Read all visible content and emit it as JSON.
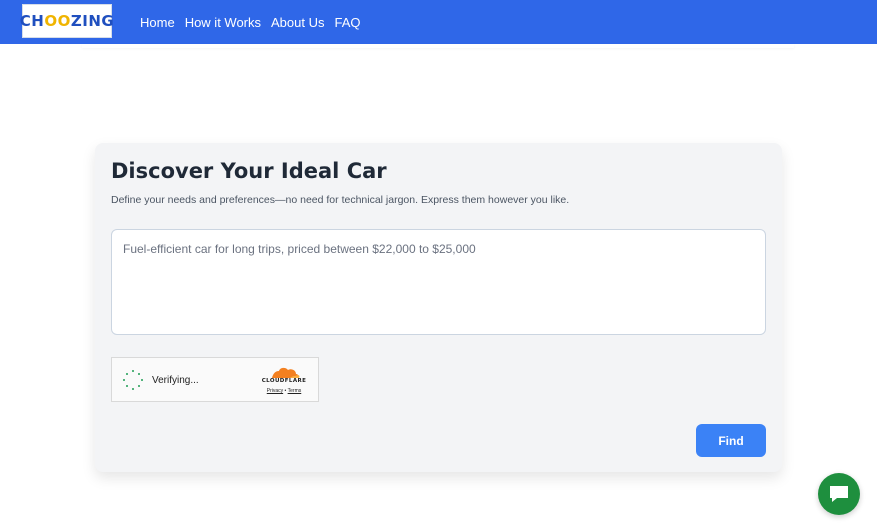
{
  "brand": {
    "logo_part1": "CH",
    "logo_part2": "OO",
    "logo_part3": "ZING",
    "colors": {
      "header": "#2f67e8",
      "logo_blue": "#1f4fbf",
      "logo_gold": "#f0b400",
      "button": "#3b82f6",
      "chat": "#1e8f3e"
    }
  },
  "nav": {
    "items": [
      {
        "label": "Home"
      },
      {
        "label": "How it Works"
      },
      {
        "label": "About Us"
      },
      {
        "label": "FAQ"
      }
    ]
  },
  "card": {
    "title": "Discover Your Ideal Car",
    "subtitle": "Define your needs and preferences—no need for technical jargon. Express them however you like.",
    "query_placeholder": "Fuel-efficient car for long trips, priced between $22,000 to $25,000",
    "query_value": ""
  },
  "captcha": {
    "status": "Verifying...",
    "provider": "CLOUDFLARE",
    "privacy_label": "Privacy",
    "separator": "•",
    "terms_label": "Terms"
  },
  "actions": {
    "find_label": "Find"
  },
  "icons": {
    "spinner": "loading-spinner-icon",
    "cloud": "cloudflare-cloud-icon",
    "chat": "chat-bubble-icon"
  }
}
